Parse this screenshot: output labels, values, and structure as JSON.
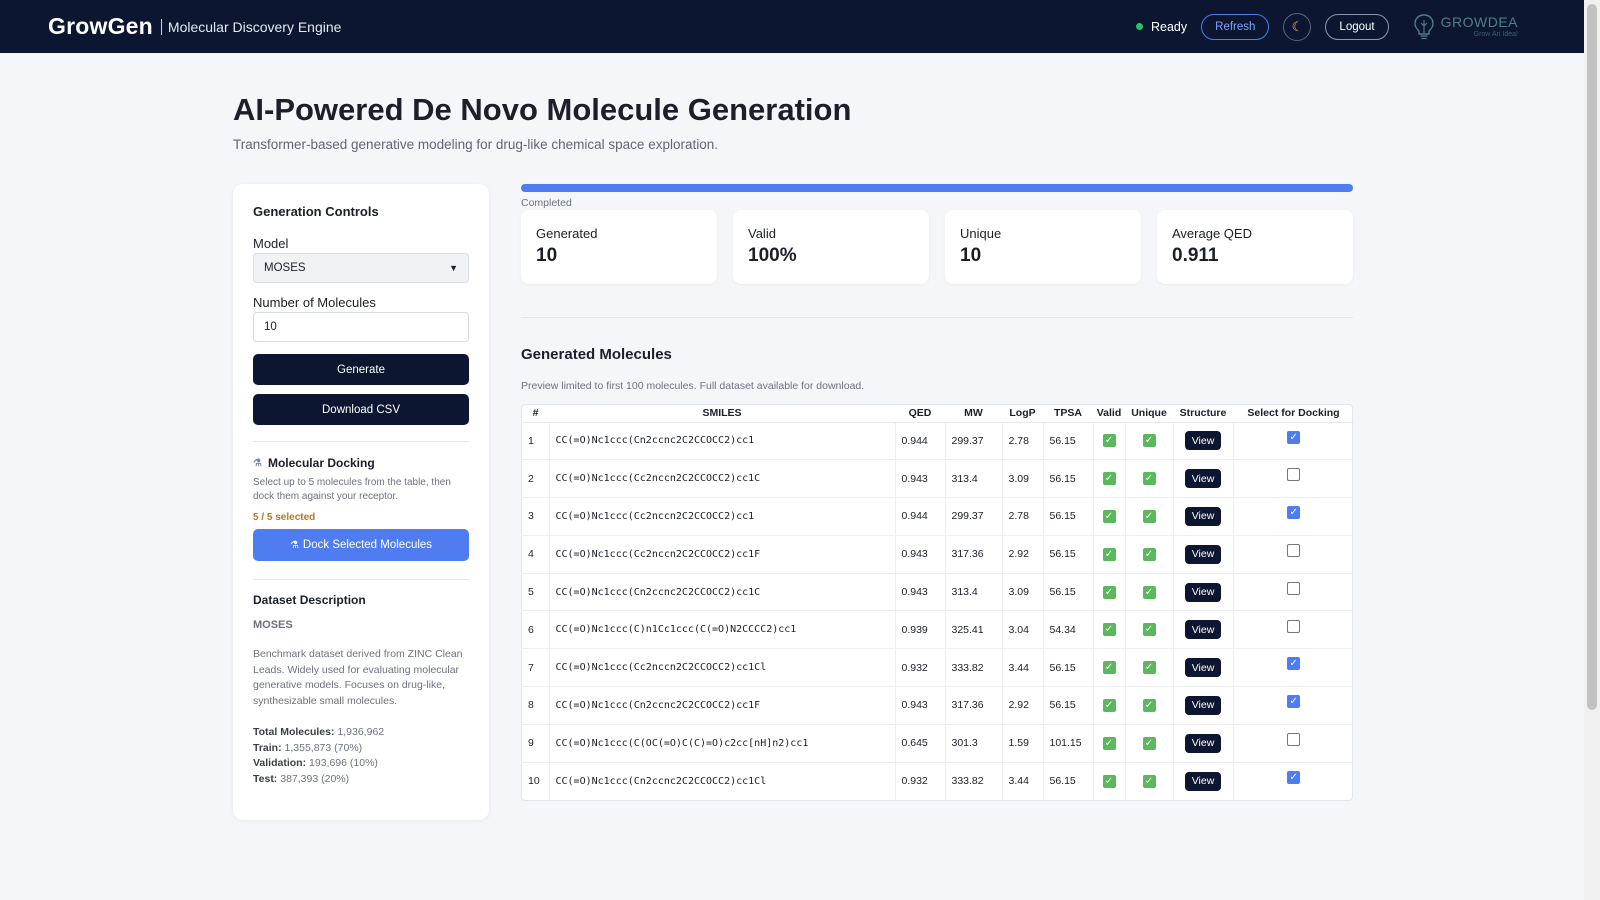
{
  "header": {
    "brand": "GrowGen",
    "subtitle": "Molecular Discovery Engine",
    "status": "Ready",
    "refresh_label": "Refresh",
    "logout_label": "Logout",
    "logo_name": "GROWDEA",
    "logo_tag": "Grow An Idea!"
  },
  "page": {
    "title": "AI-Powered De Novo Molecule Generation",
    "subtitle": "Transformer-based generative modeling for drug-like chemical space exploration."
  },
  "controls": {
    "title": "Generation Controls",
    "model_label": "Model",
    "model_value": "MOSES",
    "num_label": "Number of Molecules",
    "num_value": "10",
    "generate_label": "Generate",
    "download_label": "Download CSV"
  },
  "docking": {
    "title": "Molecular Docking",
    "description": "Select up to 5 molecules from the table, then dock them against your receptor.",
    "selected": "5 / 5 selected",
    "button_label": "Dock Selected Molecules"
  },
  "dataset": {
    "title": "Dataset Description",
    "name": "MOSES",
    "description": "Benchmark dataset derived from ZINC Clean Leads. Widely used for evaluating molecular generative models. Focuses on drug-like, synthesizable small molecules.",
    "total_label": "Total Molecules:",
    "total_value": "1,936,962",
    "train_label": "Train:",
    "train_value": "1,355,873 (70%)",
    "val_label": "Validation:",
    "val_value": "193,696 (10%)",
    "test_label": "Test:",
    "test_value": "387,393 (20%)"
  },
  "progress": {
    "label": "Completed",
    "percent": 100
  },
  "stats": [
    {
      "label": "Generated",
      "value": "10"
    },
    {
      "label": "Valid",
      "value": "100%"
    },
    {
      "label": "Unique",
      "value": "10"
    },
    {
      "label": "Average QED",
      "value": "0.911"
    }
  ],
  "results": {
    "title": "Generated Molecules",
    "note": "Preview limited to first 100 molecules. Full dataset available for download.",
    "columns": [
      "#",
      "SMILES",
      "QED",
      "MW",
      "LogP",
      "TPSA",
      "Valid",
      "Unique",
      "Structure",
      "Select for Docking"
    ],
    "view_label": "View",
    "rows": [
      {
        "n": "1",
        "smiles": "CC(=O)Nc1ccc(Cn2ccnc2C2CCOCC2)cc1",
        "qed": "0.944",
        "mw": "299.37",
        "logp": "2.78",
        "tpsa": "56.15",
        "selected": true
      },
      {
        "n": "2",
        "smiles": "CC(=O)Nc1ccc(Cc2nccn2C2CCOCC2)cc1C",
        "qed": "0.943",
        "mw": "313.4",
        "logp": "3.09",
        "tpsa": "56.15",
        "selected": false
      },
      {
        "n": "3",
        "smiles": "CC(=O)Nc1ccc(Cc2nccn2C2CCOCC2)cc1",
        "qed": "0.944",
        "mw": "299.37",
        "logp": "2.78",
        "tpsa": "56.15",
        "selected": true
      },
      {
        "n": "4",
        "smiles": "CC(=O)Nc1ccc(Cc2nccn2C2CCOCC2)cc1F",
        "qed": "0.943",
        "mw": "317.36",
        "logp": "2.92",
        "tpsa": "56.15",
        "selected": false
      },
      {
        "n": "5",
        "smiles": "CC(=O)Nc1ccc(Cn2ccnc2C2CCOCC2)cc1C",
        "qed": "0.943",
        "mw": "313.4",
        "logp": "3.09",
        "tpsa": "56.15",
        "selected": false
      },
      {
        "n": "6",
        "smiles": "CC(=O)Nc1ccc(C)n1Cc1ccc(C(=O)N2CCCC2)cc1",
        "qed": "0.939",
        "mw": "325.41",
        "logp": "3.04",
        "tpsa": "54.34",
        "selected": false
      },
      {
        "n": "7",
        "smiles": "CC(=O)Nc1ccc(Cc2nccn2C2CCOCC2)cc1Cl",
        "qed": "0.932",
        "mw": "333.82",
        "logp": "3.44",
        "tpsa": "56.15",
        "selected": true
      },
      {
        "n": "8",
        "smiles": "CC(=O)Nc1ccc(Cn2ccnc2C2CCOCC2)cc1F",
        "qed": "0.943",
        "mw": "317.36",
        "logp": "2.92",
        "tpsa": "56.15",
        "selected": true
      },
      {
        "n": "9",
        "smiles": "CC(=O)Nc1ccc(C(OC(=O)C(C)=O)c2cc[nH]n2)cc1",
        "qed": "0.645",
        "mw": "301.3",
        "logp": "1.59",
        "tpsa": "101.15",
        "selected": false
      },
      {
        "n": "10",
        "smiles": "CC(=O)Nc1ccc(Cn2ccnc2C2CCOCC2)cc1Cl",
        "qed": "0.932",
        "mw": "333.82",
        "logp": "3.44",
        "tpsa": "56.15",
        "selected": true
      }
    ]
  }
}
